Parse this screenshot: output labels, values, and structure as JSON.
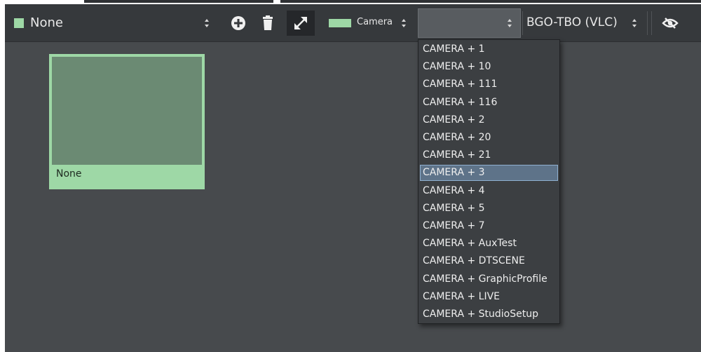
{
  "colors": {
    "accent_green": "#9ed8a6",
    "background": "#474a4d",
    "toolbar": "#36393c",
    "selection": "#5e7389"
  },
  "toolbar": {
    "layer_name": "None",
    "color_label": "Camera",
    "camera_select_value": "",
    "output_label": "BGO-TBO (VLC)",
    "icons": [
      "add-circle-icon",
      "trash-icon",
      "expand-diagonal-icon",
      "eye-slash-icon"
    ]
  },
  "tile": {
    "name": "None"
  },
  "dropdown": {
    "selected": "CAMERA + 3",
    "options": [
      "CAMERA + 1",
      "CAMERA + 10",
      "CAMERA + 111",
      "CAMERA + 116",
      "CAMERA + 2",
      "CAMERA + 20",
      "CAMERA + 21",
      "CAMERA + 3",
      "CAMERA + 4",
      "CAMERA + 5",
      "CAMERA + 7",
      "CAMERA + AuxTest",
      "CAMERA + DTSCENE",
      "CAMERA + GraphicProfile",
      "CAMERA + LIVE",
      "CAMERA + StudioSetup"
    ]
  }
}
